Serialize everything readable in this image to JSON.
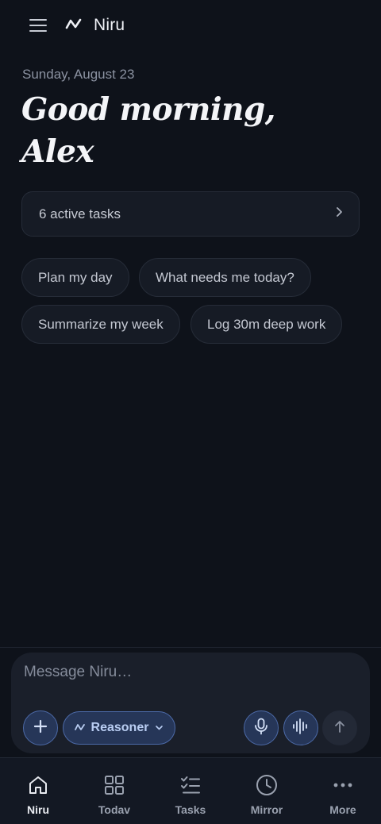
{
  "header": {
    "brand_name": "Niru",
    "menu_icon": "hamburger-menu-icon",
    "logo_icon": "wave-logo-icon"
  },
  "greeting": {
    "date": "Sunday, August 23",
    "line1": "Good morning,",
    "line2": "Alex"
  },
  "tasks_card": {
    "label": "6 active tasks",
    "icon": "chevron-right-icon"
  },
  "suggestions": [
    "Plan my day",
    "What needs me today?",
    "Summarize my week",
    "Log 30m deep work"
  ],
  "composer": {
    "placeholder": "Message Niru…",
    "value": "",
    "model_label": "Reasoner",
    "icons": {
      "add": "plus-icon",
      "model": "wave-icon",
      "dropdown": "chevron-down-icon",
      "mic": "microphone-icon",
      "voice": "waveform-icon",
      "send": "arrow-up-icon"
    }
  },
  "nav": [
    {
      "label": "Niru",
      "icon": "home-icon",
      "active": true
    },
    {
      "label": "Todav",
      "icon": "grid-icon",
      "active": false
    },
    {
      "label": "Tasks",
      "icon": "checklist-icon",
      "active": false
    },
    {
      "label": "Mirror",
      "icon": "clock-icon",
      "active": false
    },
    {
      "label": "More",
      "icon": "more-dots-icon",
      "active": false
    }
  ],
  "colors": {
    "background": "#0e121a",
    "accent": "#4c6aa8",
    "accent_fill": "#263658"
  }
}
